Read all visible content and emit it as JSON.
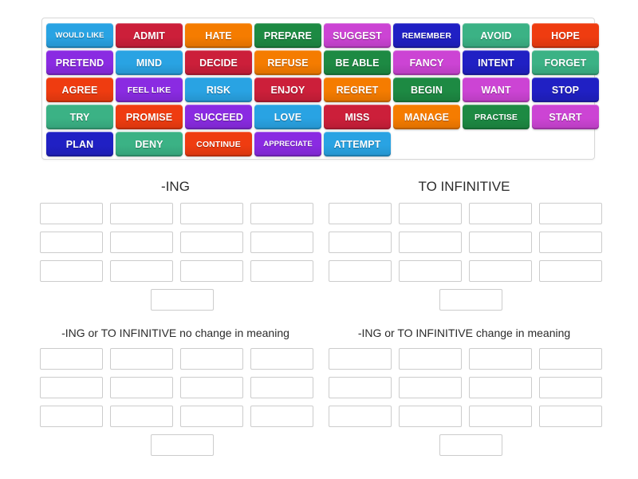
{
  "wordbank": {
    "name": "verb-pattern-word-bank",
    "rows": [
      [
        {
          "label": "WOULD LIKE",
          "color": "#29a3e3"
        },
        {
          "label": "ADMIT",
          "color": "#cc1f3a"
        },
        {
          "label": "HATE",
          "color": "#f57c00"
        },
        {
          "label": "PREPARE",
          "color": "#1d8a43"
        },
        {
          "label": "SUGGEST",
          "color": "#cc44d4"
        },
        {
          "label": "REMEMBER",
          "color": "#2020c4"
        },
        {
          "label": "AVOID",
          "color": "#3bb285"
        },
        {
          "label": "HOPE",
          "color": "#ef3c10"
        }
      ],
      [
        {
          "label": "PRETEND",
          "color": "#8a2be2"
        },
        {
          "label": "MIND",
          "color": "#29a3e3"
        },
        {
          "label": "DECIDE",
          "color": "#cc1f3a"
        },
        {
          "label": "REFUSE",
          "color": "#f57c00"
        },
        {
          "label": "BE ABLE",
          "color": "#1d8a43"
        },
        {
          "label": "FANCY",
          "color": "#cc44d4"
        },
        {
          "label": "INTENT",
          "color": "#2020c4"
        },
        {
          "label": "FORGET",
          "color": "#3bb285"
        }
      ],
      [
        {
          "label": "AGREE",
          "color": "#ef3c10"
        },
        {
          "label": "FEEL LIKE",
          "color": "#8a2be2"
        },
        {
          "label": "RISK",
          "color": "#29a3e3"
        },
        {
          "label": "ENJOY",
          "color": "#cc1f3a"
        },
        {
          "label": "REGRET",
          "color": "#f57c00"
        },
        {
          "label": "BEGIN",
          "color": "#1d8a43"
        },
        {
          "label": "WANT",
          "color": "#cc44d4"
        },
        {
          "label": "STOP",
          "color": "#2020c4"
        }
      ],
      [
        {
          "label": "TRY",
          "color": "#3bb285"
        },
        {
          "label": "PROMISE",
          "color": "#ef3c10"
        },
        {
          "label": "SUCCEED",
          "color": "#8a2be2"
        },
        {
          "label": "LOVE",
          "color": "#29a3e3"
        },
        {
          "label": "MISS",
          "color": "#cc1f3a"
        },
        {
          "label": "MANAGE",
          "color": "#f57c00"
        },
        {
          "label": "PRACTISE",
          "color": "#1d8a43"
        },
        {
          "label": "START",
          "color": "#cc44d4"
        }
      ],
      [
        {
          "label": "PLAN",
          "color": "#2020c4"
        },
        {
          "label": "DENY",
          "color": "#3bb285"
        },
        {
          "label": "CONTINUE",
          "color": "#ef3c10"
        },
        {
          "label": "APPRECIATE",
          "color": "#8a2be2"
        },
        {
          "label": "ATTEMPT",
          "color": "#29a3e3"
        }
      ]
    ]
  },
  "categories": [
    {
      "id": "ing",
      "title": "-ING",
      "slot_count": 13
    },
    {
      "id": "to-infinitive",
      "title": "TO INFINITIVE",
      "slot_count": 13
    },
    {
      "id": "no-change",
      "title": "-ING or TO INFINITIVE no change in meaning",
      "slot_count": 13
    },
    {
      "id": "change",
      "title": "-ING or TO INFINITIVE change in meaning",
      "slot_count": 13
    }
  ],
  "colors": {
    "slot_border": "#cccccc",
    "bank_border": "#d8d8d8",
    "page_background": "#ffffff",
    "heading_text": "#2b2b2b"
  }
}
